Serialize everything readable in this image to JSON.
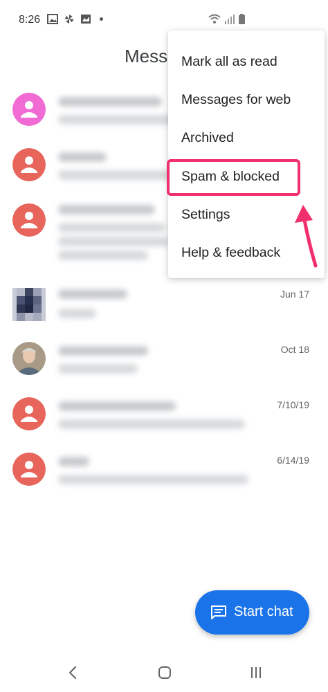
{
  "status_bar": {
    "time": "8:26",
    "left_icons": [
      "image-icon",
      "pinwheel-icon",
      "gallery-icon",
      "notification-dot"
    ],
    "right_icons": [
      "wifi-icon",
      "signal-icon",
      "battery-icon"
    ]
  },
  "app": {
    "title": "Messa"
  },
  "overflow_menu": {
    "items": [
      {
        "label": "Mark all as read"
      },
      {
        "label": "Messages for web"
      },
      {
        "label": "Archived"
      },
      {
        "label": "Spam & blocked",
        "highlighted": true
      },
      {
        "label": "Settings"
      },
      {
        "label": "Help & feedback"
      }
    ],
    "highlight_color": "#f0306c"
  },
  "conversations": [
    {
      "avatar": "default-person-avatar",
      "avatar_color": "#f06bd3",
      "date": ""
    },
    {
      "avatar": "default-person-avatar",
      "avatar_color": "#e8655b",
      "date": ""
    },
    {
      "avatar": "default-person-avatar",
      "avatar_color": "#e8655b",
      "date": ""
    },
    {
      "avatar": "pixelated-photo-avatar",
      "avatar_color": "#3b4a6b",
      "date": "Jun 17"
    },
    {
      "avatar": "photo-avatar",
      "avatar_color": "#8d7c66",
      "date": "Oct 18"
    },
    {
      "avatar": "default-person-avatar",
      "avatar_color": "#e8655b",
      "date": "7/10/19"
    },
    {
      "avatar": "default-person-avatar",
      "avatar_color": "#e8655b",
      "date": "6/14/19"
    }
  ],
  "fab": {
    "label": "Start chat",
    "icon": "chat-icon",
    "color": "#1a73e8"
  },
  "nav_bar": {
    "buttons": [
      "back-icon",
      "home-icon",
      "recents-icon"
    ]
  }
}
